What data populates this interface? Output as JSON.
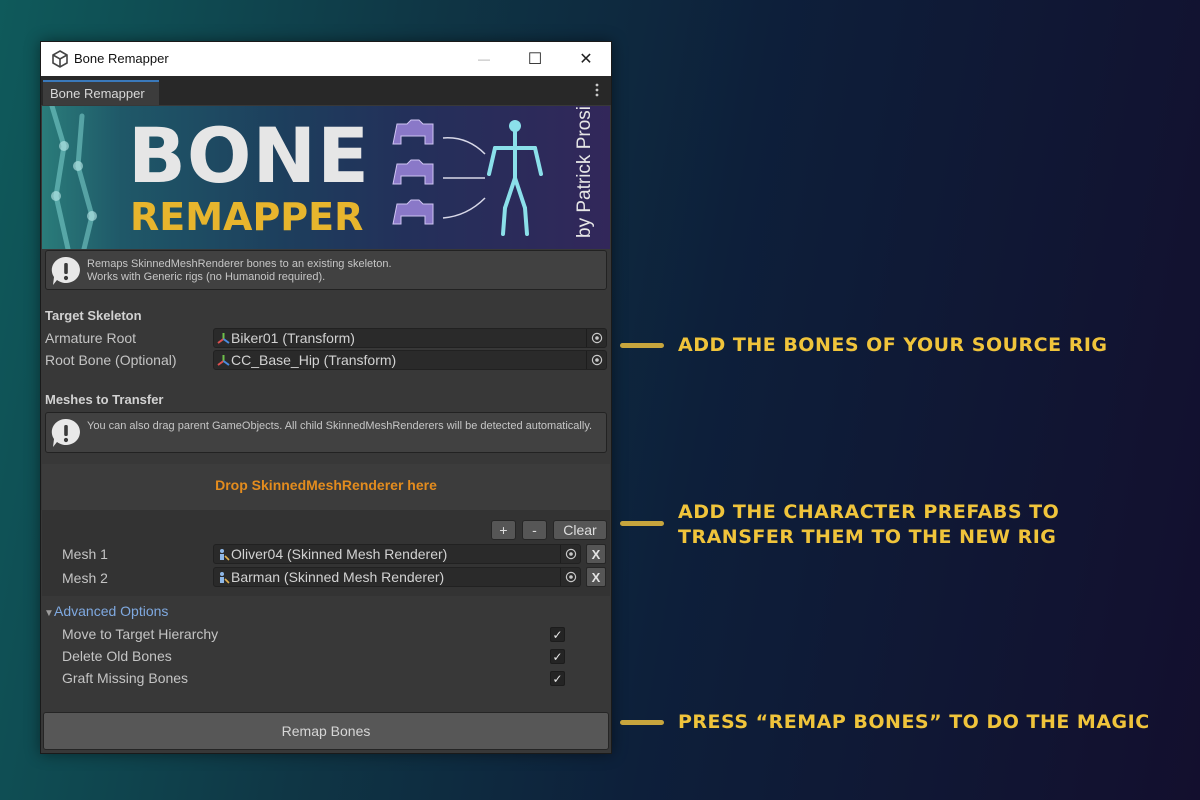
{
  "window": {
    "title": "Bone Remapper",
    "tab_label": "Bone Remapper",
    "minimize_glyph": "—",
    "maximize_glyph": "☐",
    "close_glyph": "✕"
  },
  "banner": {
    "title": "BONE",
    "subtitle": "REMAPPER",
    "author": "by Patrick Prosic"
  },
  "help": {
    "line1": "Remaps SkinnedMeshRenderer bones to an existing skeleton.",
    "line2": "Works with Generic rigs (no Humanoid required)."
  },
  "target_skeleton": {
    "title": "Target Skeleton",
    "armature_label": "Armature Root",
    "armature_value": "Biker01 (Transform)",
    "rootbone_label": "Root Bone (Optional)",
    "rootbone_value": "CC_Base_Hip (Transform)"
  },
  "meshes": {
    "title": "Meshes to Transfer",
    "help": "You can also drag parent GameObjects. All child SkinnedMeshRenderers will be detected automatically.",
    "drop_text": "Drop SkinnedMeshRenderer here",
    "add_label": "+",
    "remove_label": "-",
    "clear_label": "Clear",
    "remove_item_label": "X",
    "items": [
      {
        "label": "Mesh 1",
        "value": "Oliver04 (Skinned Mesh Renderer)"
      },
      {
        "label": "Mesh 2",
        "value": "Barman (Skinned Mesh Renderer)"
      }
    ]
  },
  "advanced": {
    "title": "Advanced Options",
    "options": [
      {
        "label": "Move to Target Hierarchy",
        "checked": true
      },
      {
        "label": "Delete Old Bones",
        "checked": true
      },
      {
        "label": "Graft Missing Bones",
        "checked": true
      }
    ],
    "check_glyph": "✓"
  },
  "remap_button": "Remap Bones",
  "callouts": {
    "first": "ADD THE BONES OF YOUR SOURCE RIG",
    "second_line1": "ADD THE CHARACTER PREFABS TO",
    "second_line2": "TRANSFER THEM TO THE NEW RIG",
    "third": "PRESS “REMAP BONES” TO DO THE MAGIC"
  },
  "colors": {
    "accent_gold": "#f0c43b",
    "drop_orange": "#e38c1e",
    "foldout_blue": "#7fa9e0",
    "panel": "#383838"
  }
}
